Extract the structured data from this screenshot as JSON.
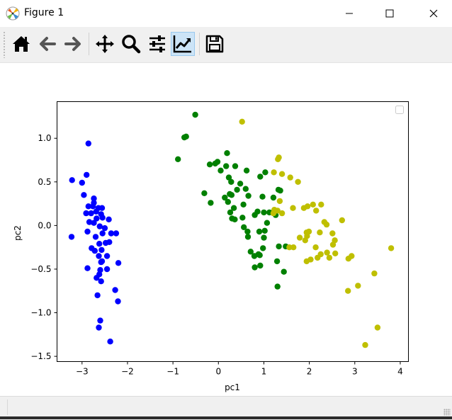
{
  "window": {
    "title": "Figure 1"
  },
  "toolbar": {
    "buttons": [
      {
        "name": "home-button",
        "icon": "home-icon"
      },
      {
        "name": "back-button",
        "icon": "arrow-left-icon"
      },
      {
        "name": "forward-button",
        "icon": "arrow-right-icon"
      },
      {
        "name": "pan-button",
        "icon": "move-icon"
      },
      {
        "name": "zoom-button",
        "icon": "magnifier-icon"
      },
      {
        "name": "configure-subplots-button",
        "icon": "sliders-icon"
      },
      {
        "name": "edit-axis-button",
        "icon": "trend-chart-icon",
        "active": true
      },
      {
        "name": "save-button",
        "icon": "floppy-disk-icon"
      }
    ]
  },
  "chart_data": {
    "type": "scatter",
    "xlabel": "pc1",
    "ylabel": "pc2",
    "xlim": [
      -3.55,
      4.18
    ],
    "ylim": [
      -1.56,
      1.42
    ],
    "xticks": [
      -3,
      -2,
      -1,
      0,
      1,
      2,
      3,
      4
    ],
    "xtick_labels": [
      "−3",
      "−2",
      "−1",
      "0",
      "1",
      "2",
      "3",
      "4"
    ],
    "yticks": [
      -1.5,
      -1.0,
      -0.5,
      0.0,
      0.5,
      1.0
    ],
    "ytick_labels": [
      "−1.5",
      "−1.0",
      "−0.5",
      "0.0",
      "0.5",
      "1.0"
    ],
    "grid": false,
    "legend": {
      "location": "top-right",
      "entries": []
    },
    "series": [
      {
        "color": "#0000ff",
        "points": [
          [
            -2.86,
            0.94
          ],
          [
            -3.22,
            0.52
          ],
          [
            -3.0,
            0.49
          ],
          [
            -2.9,
            0.58
          ],
          [
            -2.96,
            0.35
          ],
          [
            -2.74,
            0.31
          ],
          [
            -2.74,
            0.26
          ],
          [
            -2.86,
            0.22
          ],
          [
            -2.76,
            0.22
          ],
          [
            -2.64,
            0.2
          ],
          [
            -2.56,
            0.2
          ],
          [
            -2.69,
            0.16
          ],
          [
            -2.58,
            0.13
          ],
          [
            -2.91,
            0.14
          ],
          [
            -2.8,
            0.14
          ],
          [
            -2.55,
            0.09
          ],
          [
            -2.68,
            0.08
          ],
          [
            -2.84,
            0.04
          ],
          [
            -2.74,
            0.03
          ],
          [
            -2.41,
            0.07
          ],
          [
            -2.61,
            -0.01
          ],
          [
            -2.5,
            -0.03
          ],
          [
            -2.55,
            -0.09
          ],
          [
            -2.36,
            -0.09
          ],
          [
            -2.88,
            -0.07
          ],
          [
            -2.7,
            -0.13
          ],
          [
            -2.25,
            -0.09
          ],
          [
            -3.23,
            -0.13
          ],
          [
            -2.4,
            -0.19
          ],
          [
            -2.62,
            -0.21
          ],
          [
            -2.48,
            -0.2
          ],
          [
            -2.79,
            -0.26
          ],
          [
            -2.72,
            -0.29
          ],
          [
            -2.57,
            -0.28
          ],
          [
            -2.63,
            -0.35
          ],
          [
            -2.45,
            -0.35
          ],
          [
            -2.56,
            -0.41
          ],
          [
            -2.2,
            -0.43
          ],
          [
            -2.88,
            -0.49
          ],
          [
            -2.58,
            -0.42
          ],
          [
            -2.6,
            -0.51
          ],
          [
            -2.45,
            -0.5
          ],
          [
            -2.62,
            -0.56
          ],
          [
            -2.68,
            -0.6
          ],
          [
            -2.58,
            -0.64
          ],
          [
            -2.27,
            -0.74
          ],
          [
            -2.66,
            -0.8
          ],
          [
            -2.21,
            -0.87
          ],
          [
            -2.6,
            -1.09
          ],
          [
            -2.63,
            -1.17
          ],
          [
            -2.38,
            -1.33
          ]
        ]
      },
      {
        "color": "#008000",
        "points": [
          [
            -0.51,
            1.27
          ],
          [
            -0.75,
            1.01
          ],
          [
            -0.71,
            1.02
          ],
          [
            -0.89,
            0.76
          ],
          [
            0.19,
            0.83
          ],
          [
            -0.19,
            0.7
          ],
          [
            -0.07,
            0.71
          ],
          [
            -0.02,
            0.73
          ],
          [
            0.17,
            0.68
          ],
          [
            0.37,
            0.68
          ],
          [
            0.05,
            0.63
          ],
          [
            0.23,
            0.55
          ],
          [
            0.62,
            0.63
          ],
          [
            0.48,
            0.48
          ],
          [
            0.92,
            0.56
          ],
          [
            1.03,
            0.61
          ],
          [
            0.28,
            0.5
          ],
          [
            0.6,
            0.42
          ],
          [
            0.41,
            0.41
          ],
          [
            1.32,
            0.41
          ],
          [
            1.36,
            0.4
          ],
          [
            0.25,
            0.36
          ],
          [
            -0.31,
            0.37
          ],
          [
            0.14,
            0.32
          ],
          [
            0.21,
            0.27
          ],
          [
            0.29,
            0.35
          ],
          [
            0.66,
            0.34
          ],
          [
            1.21,
            0.32
          ],
          [
            -0.17,
            0.26
          ],
          [
            0.55,
            0.24
          ],
          [
            0.97,
            0.33
          ],
          [
            0.34,
            0.2
          ],
          [
            0.26,
            0.15
          ],
          [
            0.86,
            0.16
          ],
          [
            1.0,
            0.15
          ],
          [
            0.8,
            0.12
          ],
          [
            0.53,
            0.09
          ],
          [
            0.36,
            0.07
          ],
          [
            0.3,
            0.08
          ],
          [
            1.12,
            0.15
          ],
          [
            1.26,
            0.12
          ],
          [
            0.56,
            -0.02
          ],
          [
            1.07,
            0.03
          ],
          [
            0.9,
            -0.07
          ],
          [
            1.02,
            -0.06
          ],
          [
            0.64,
            -0.07
          ],
          [
            1.0,
            -0.14
          ],
          [
            0.98,
            -0.26
          ],
          [
            0.71,
            -0.3
          ],
          [
            0.79,
            -0.35
          ],
          [
            1.48,
            -0.24
          ],
          [
            1.29,
            -0.41
          ],
          [
            0.8,
            -0.48
          ],
          [
            1.44,
            -0.53
          ],
          [
            1.3,
            -0.7
          ],
          [
            0.88,
            -0.33
          ],
          [
            0.92,
            -0.46
          ],
          [
            1.33,
            -0.24
          ],
          [
            0.91,
            -0.34
          ],
          [
            0.65,
            -0.13
          ]
        ]
      },
      {
        "color": "#bfbf00",
        "points": [
          [
            0.52,
            1.19
          ],
          [
            1.31,
            0.76
          ],
          [
            1.33,
            0.78
          ],
          [
            1.22,
            0.61
          ],
          [
            1.4,
            0.59
          ],
          [
            1.58,
            0.55
          ],
          [
            1.75,
            0.5
          ],
          [
            1.35,
            0.28
          ],
          [
            1.64,
            0.2
          ],
          [
            1.3,
            0.17
          ],
          [
            1.23,
            0.18
          ],
          [
            1.21,
            0.14
          ],
          [
            1.4,
            0.14
          ],
          [
            1.96,
            0.22
          ],
          [
            2.08,
            0.24
          ],
          [
            2.26,
            0.24
          ],
          [
            1.88,
            0.2
          ],
          [
            2.15,
            0.17
          ],
          [
            2.72,
            0.06
          ],
          [
            2.33,
            0.04
          ],
          [
            2.38,
            0.01
          ],
          [
            2.51,
            -0.09
          ],
          [
            1.94,
            -0.08
          ],
          [
            1.99,
            -0.07
          ],
          [
            2.23,
            -0.08
          ],
          [
            1.79,
            -0.14
          ],
          [
            1.95,
            -0.12
          ],
          [
            1.91,
            -0.17
          ],
          [
            2.56,
            -0.17
          ],
          [
            2.52,
            -0.22
          ],
          [
            1.56,
            -0.25
          ],
          [
            1.65,
            -0.25
          ],
          [
            2.14,
            -0.25
          ],
          [
            2.25,
            -0.33
          ],
          [
            2.39,
            -0.31
          ],
          [
            2.57,
            -0.32
          ],
          [
            2.03,
            -0.39
          ],
          [
            2.18,
            -0.37
          ],
          [
            2.44,
            -0.37
          ],
          [
            2.86,
            -0.38
          ],
          [
            2.93,
            -0.35
          ],
          [
            3.8,
            -0.26
          ],
          [
            3.43,
            -0.55
          ],
          [
            3.07,
            -0.69
          ],
          [
            2.85,
            -0.75
          ],
          [
            3.5,
            -1.17
          ],
          [
            3.23,
            -1.37
          ],
          [
            1.94,
            -0.41
          ]
        ]
      }
    ]
  }
}
